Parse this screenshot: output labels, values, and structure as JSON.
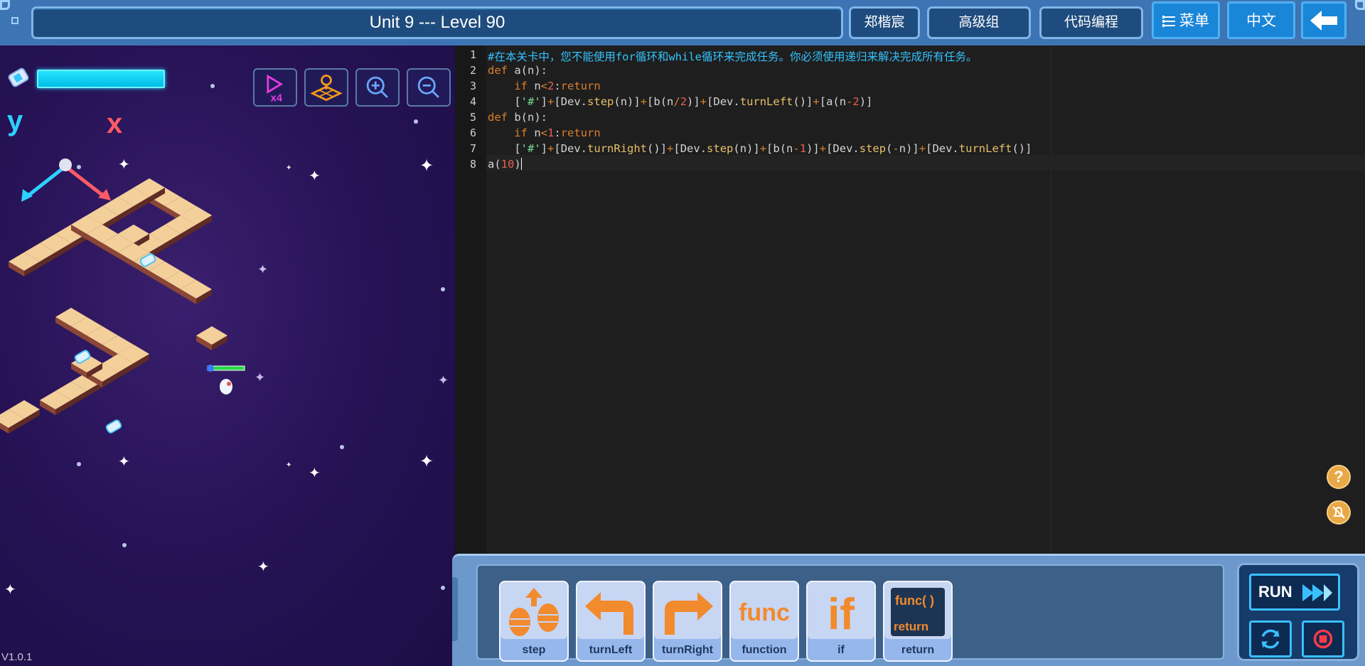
{
  "header": {
    "level_title": "Unit 9 --- Level 90",
    "user_name": "郑楷宸",
    "group": "高级组",
    "mode": "代码编程",
    "menu_label": "菜单",
    "language": "中文"
  },
  "game": {
    "speed_label": "x4",
    "axis_x": "x",
    "axis_y": "y",
    "energy_level": 1.0,
    "version": "V1.0.1"
  },
  "editor": {
    "line_numbers": [
      "1",
      "2",
      "3",
      "4",
      "5",
      "6",
      "7",
      "8"
    ]
  },
  "palette": {
    "blocks": [
      {
        "label": "step"
      },
      {
        "label": "turnLeft"
      },
      {
        "label": "turnRight"
      },
      {
        "label": "function",
        "icon_text": "func"
      },
      {
        "label": "if",
        "icon_text": "if"
      },
      {
        "label": "return",
        "icon_text": "func( )",
        "icon_text2": "return"
      }
    ],
    "run_label": "RUN"
  },
  "colors": {
    "accent_blue": "#1a86d8",
    "header_bg": "#3d74b3",
    "comment": "#33c3ff",
    "keyword": "#dc7f2b"
  },
  "icons": [
    "speed-x4-icon",
    "map-grid-icon",
    "zoom-in-icon",
    "zoom-out-icon",
    "help-icon",
    "mute-icon",
    "refresh-icon",
    "stop-icon",
    "back-arrow-icon"
  ]
}
